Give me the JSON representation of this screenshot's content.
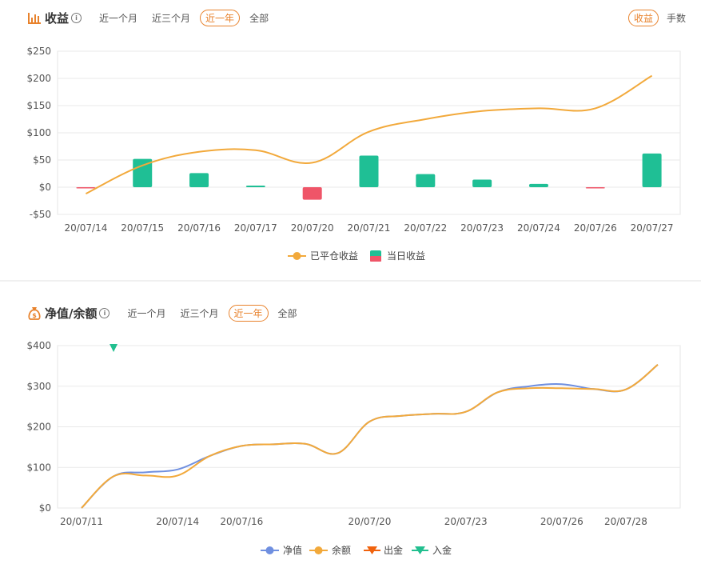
{
  "profit_panel": {
    "title": "收益",
    "tabs": [
      "近一个月",
      "近三个月",
      "近一年",
      "全部"
    ],
    "active_tab": 2,
    "mode_tabs": [
      "收益",
      "手数"
    ],
    "active_mode": 0
  },
  "networth_panel": {
    "title": "净值/余额",
    "tabs": [
      "近一个月",
      "近三个月",
      "近一年",
      "全部"
    ],
    "active_tab": 2
  },
  "colors": {
    "accent": "#e8822c",
    "line_orange": "#f2a93b",
    "bar_green": "#1fbf95",
    "bar_red": "#ef5568",
    "line_blue": "#6f8fe0",
    "withdraw": "#f0620d",
    "deposit": "#22bf8f"
  },
  "chart_data": [
    {
      "type": "bar",
      "categories": [
        "20/07/14",
        "20/07/15",
        "20/07/16",
        "20/07/17",
        "20/07/20",
        "20/07/21",
        "20/07/22",
        "20/07/23",
        "20/07/24",
        "20/07/26",
        "20/07/27"
      ],
      "ylim": [
        -50,
        250
      ],
      "yticks": [
        "-$50",
        "$0",
        "$50",
        "$100",
        "$150",
        "$200",
        "$250"
      ],
      "ytick_values": [
        -50,
        0,
        50,
        100,
        150,
        200,
        250
      ],
      "series": [
        {
          "name": "已平仓收益",
          "type": "line",
          "values": [
            -12,
            40,
            65,
            68,
            45,
            102,
            125,
            140,
            145,
            145,
            205
          ]
        },
        {
          "name": "当日收益",
          "type": "bar",
          "values": [
            -1,
            52,
            26,
            3,
            -23,
            58,
            24,
            14,
            6,
            -1,
            62
          ]
        }
      ],
      "legend_position": "bottom-center",
      "grid": true
    },
    {
      "type": "line",
      "x": [
        "20/07/11",
        "20/07/12",
        "20/07/13",
        "20/07/14",
        "20/07/15",
        "20/07/16",
        "20/07/17",
        "20/07/18",
        "20/07/19",
        "20/07/20",
        "20/07/21",
        "20/07/22",
        "20/07/23",
        "20/07/24",
        "20/07/25",
        "20/07/26",
        "20/07/27",
        "20/07/28",
        "20/07/29"
      ],
      "xticks": [
        "20/07/11",
        "20/07/14",
        "20/07/16",
        "20/07/20",
        "20/07/23",
        "20/07/26",
        "20/07/28"
      ],
      "ylim": [
        0,
        400
      ],
      "yticks": [
        "$0",
        "$100",
        "$200",
        "$300",
        "$400"
      ],
      "ytick_values": [
        0,
        100,
        200,
        300,
        400
      ],
      "series": [
        {
          "name": "净值",
          "values": [
            0,
            78,
            88,
            95,
            128,
            153,
            157,
            158,
            135,
            213,
            227,
            232,
            237,
            285,
            300,
            305,
            293,
            292,
            353
          ]
        },
        {
          "name": "余额",
          "values": [
            0,
            78,
            80,
            80,
            128,
            153,
            157,
            158,
            135,
            213,
            227,
            232,
            237,
            285,
            295,
            295,
            293,
            292,
            353
          ]
        },
        {
          "name": "出金",
          "values": []
        },
        {
          "name": "入金",
          "values": [
            {
              "x": "20/07/12",
              "y": 400
            }
          ]
        }
      ],
      "legend_position": "bottom-center",
      "grid": true
    }
  ]
}
